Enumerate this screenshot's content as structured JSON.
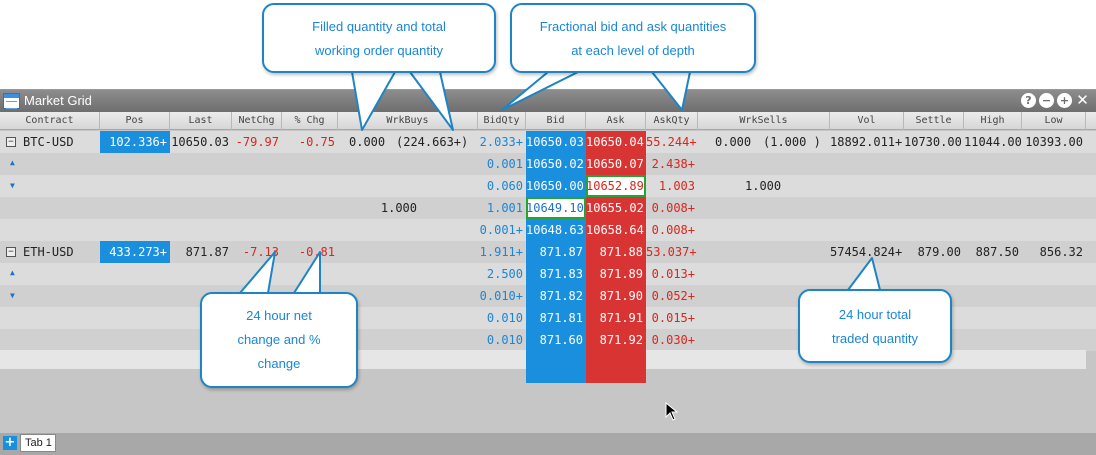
{
  "window": {
    "title": "Market Grid"
  },
  "window_buttons": [
    "?",
    "−",
    "+",
    "✕"
  ],
  "columns": [
    "Contract",
    "Pos",
    "Last",
    "NetChg",
    "% Chg",
    "WrkBuys",
    "BidQty",
    "Bid",
    "Ask",
    "AskQty",
    "WrkSells",
    "Vol",
    "Settle",
    "High",
    "Low"
  ],
  "btc": {
    "contract": "BTC-USD",
    "pos": "102.336+",
    "last": "10650.03",
    "netchg": "-79.97",
    "pchg": "-0.75",
    "wrkbuys_filled": "0.000",
    "wrkbuys_working": "(224.663+)",
    "wrksells_filled": "0.000",
    "wrksells_working": "(1.000 )",
    "vol": "18892.011+",
    "settle": "10730.00",
    "high": "11044.00",
    "low": "10393.00",
    "depth": [
      {
        "bidqty": "2.033+",
        "bid": "10650.03",
        "ask": "10650.04",
        "askqty": "55.244+",
        "wrkbuys": "",
        "wrksells": ""
      },
      {
        "bidqty": "0.001",
        "bid": "10650.02",
        "ask": "10650.07",
        "askqty": "2.438+",
        "wrkbuys": "",
        "wrksells": ""
      },
      {
        "bidqty": "0.060",
        "bid": "10650.00",
        "ask": "10652.89",
        "askqty": "1.003",
        "wrkbuys": "",
        "wrksells": "1.000"
      },
      {
        "bidqty": "1.001",
        "bid": "10649.10",
        "ask": "10655.02",
        "askqty": "0.008+",
        "wrkbuys": "1.000",
        "wrksells": ""
      },
      {
        "bidqty": "0.001+",
        "bid": "10648.63",
        "ask": "10658.64",
        "askqty": "0.008+",
        "wrkbuys": "",
        "wrksells": ""
      }
    ]
  },
  "eth": {
    "contract": "ETH-USD",
    "pos": "433.273+",
    "last": "871.87",
    "netchg": "-7.13",
    "pchg": "-0.81",
    "vol": "57454.824+",
    "settle": "879.00",
    "high": "887.50",
    "low": "856.32",
    "depth": [
      {
        "bidqty": "1.911+",
        "bid": "871.87",
        "ask": "871.88",
        "askqty": "53.037+"
      },
      {
        "bidqty": "2.500",
        "bid": "871.83",
        "ask": "871.89",
        "askqty": "0.013+"
      },
      {
        "bidqty": "0.010+",
        "bid": "871.82",
        "ask": "871.90",
        "askqty": "0.052+"
      },
      {
        "bidqty": "0.010",
        "bid": "871.81",
        "ask": "871.91",
        "askqty": "0.015+"
      },
      {
        "bidqty": "0.010",
        "bid": "871.60",
        "ask": "871.92",
        "askqty": "0.030+"
      }
    ]
  },
  "tabs": {
    "add": "+",
    "tab1": "Tab 1"
  },
  "callouts": {
    "filled": [
      "Filled quantity and  total",
      "working order quantity"
    ],
    "fractional": [
      "Fractional bid and ask quantities",
      "at each level of depth"
    ],
    "netchange": [
      "24 hour net",
      "change and %",
      "change"
    ],
    "volume": [
      "24 hour total",
      "traded quantity"
    ]
  },
  "colors": {
    "accent": "#1a8fdd",
    "ask": "#d93434",
    "down": "#d9261c",
    "callout_border": "#1d84c6"
  }
}
